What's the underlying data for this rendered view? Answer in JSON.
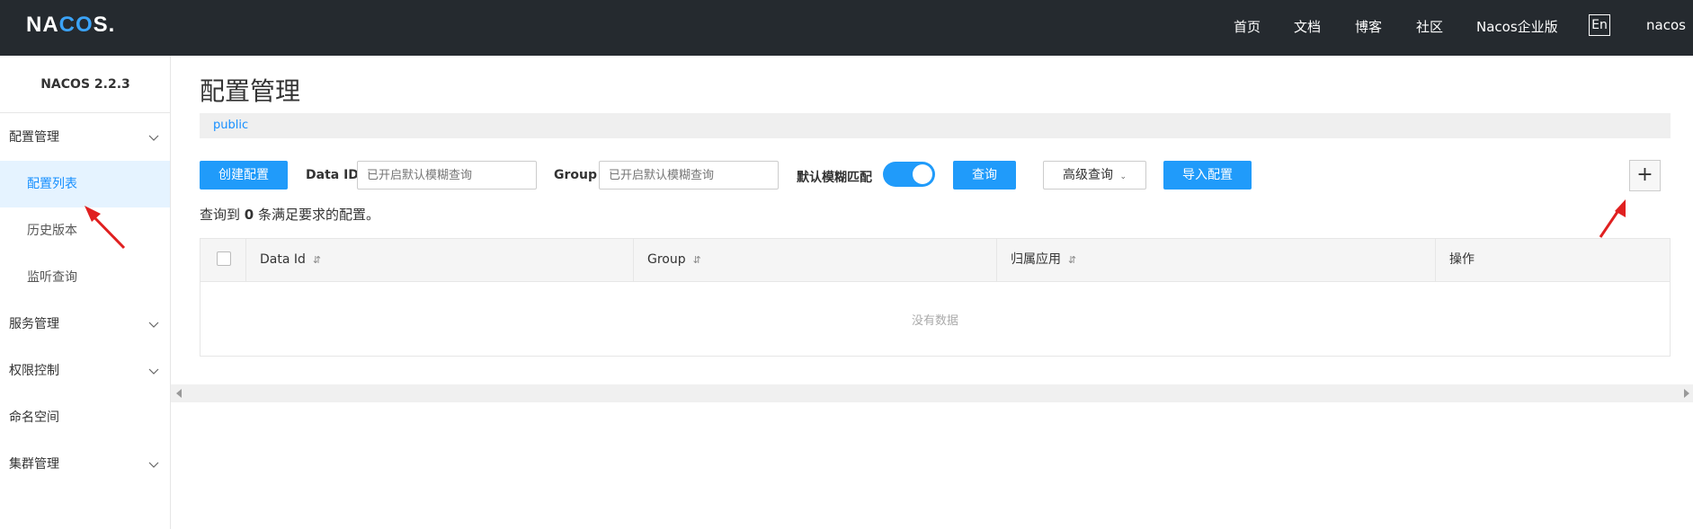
{
  "brand": {
    "logo_prefix": "NA",
    "logo_oo": "CO",
    "logo_suffix": "S."
  },
  "topnav": {
    "items": [
      "首页",
      "文档",
      "博客",
      "社区",
      "Nacos企业版"
    ],
    "lang": "En",
    "user": "nacos"
  },
  "sidebar": {
    "version": "NACOS 2.2.3",
    "items": [
      {
        "label": "配置管理",
        "expandable": true
      },
      {
        "label": "配置列表",
        "active": true
      },
      {
        "label": "历史版本"
      },
      {
        "label": "监听查询"
      },
      {
        "label": "服务管理",
        "expandable": true
      },
      {
        "label": "权限控制",
        "expandable": true
      },
      {
        "label": "命名空间"
      },
      {
        "label": "集群管理",
        "expandable": true
      }
    ]
  },
  "main": {
    "title": "配置管理",
    "namespace": "public",
    "create_button": "创建配置",
    "dataid_label": "Data ID",
    "dataid_placeholder": "已开启默认模糊查询",
    "group_label": "Group",
    "group_placeholder": "已开启默认模糊查询",
    "fuzzy_label": "默认模糊匹配",
    "fuzzy_enabled": true,
    "query_button": "查询",
    "advanced_button": "高级查询",
    "import_button": "导入配置",
    "plus_button": "+",
    "result_prefix": "查询到",
    "result_count": "0",
    "result_suffix": "条满足要求的配置。"
  },
  "table": {
    "columns": [
      "Data Id",
      "Group",
      "归属应用",
      "操作"
    ],
    "sort_icon": "⇵",
    "empty_text": "没有数据"
  },
  "colors": {
    "accent": "#209bfa",
    "topbar": "#252a2f",
    "annotation": "#e02020"
  }
}
